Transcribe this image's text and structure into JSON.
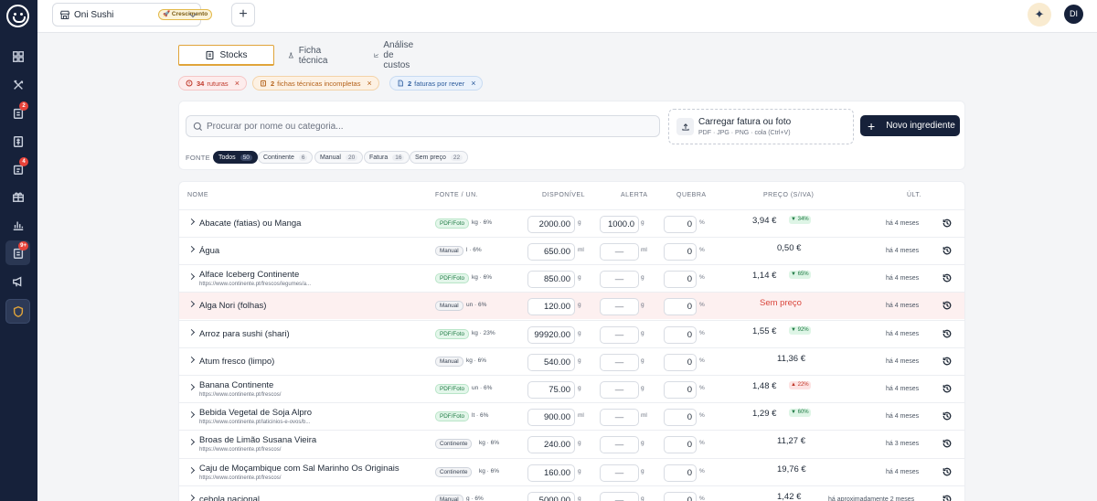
{
  "topbar": {
    "restaurant_name": "Oni Sushi",
    "plan_badge": "🚀 Crescimento",
    "add_label": "+",
    "ai_icon": "sparkle-icon",
    "avatar_initials": "DI"
  },
  "sidebar": {
    "items": [
      {
        "icon": "dashboard-icon",
        "badge": ""
      },
      {
        "icon": "utensils-icon",
        "badge": ""
      },
      {
        "icon": "orders-icon",
        "badge": "2"
      },
      {
        "icon": "invoice-icon",
        "badge": ""
      },
      {
        "icon": "delivery-icon",
        "badge": "4"
      },
      {
        "icon": "gift-icon",
        "badge": ""
      },
      {
        "icon": "chart-icon",
        "badge": ""
      },
      {
        "icon": "stock-icon",
        "badge": "9+"
      },
      {
        "icon": "megaphone-icon",
        "badge": ""
      },
      {
        "icon": "shield-icon",
        "badge": ""
      }
    ]
  },
  "tabs": [
    {
      "label": "Stocks",
      "selected": true
    },
    {
      "label": "Ficha técnica",
      "selected": false
    },
    {
      "label": "Análise de custos",
      "selected": false
    }
  ],
  "alerts": [
    {
      "count": "34",
      "label": "ruturas",
      "color": "#c0392b"
    },
    {
      "count": "2",
      "label": "fichas técnicas incompletas",
      "color": "#b4621a"
    },
    {
      "count": "2",
      "label": "faturas por rever",
      "color": "#2a5a9b"
    }
  ],
  "toolbar": {
    "search_placeholder": "Procurar por nome ou categoria...",
    "upload_title": "Carregar fatura ou foto",
    "upload_hint": "PDF · JPG · PNG · cola (Ctrl+V)",
    "new_button": "Novo ingrediente",
    "source_label": "FONTE",
    "filters": [
      {
        "label": "Todos",
        "count": "50",
        "selected": true
      },
      {
        "label": "Continente",
        "count": "6",
        "selected": false
      },
      {
        "label": "Manual",
        "count": "20",
        "selected": false
      },
      {
        "label": "Fatura",
        "count": "16",
        "selected": false
      },
      {
        "label": "Sem preço",
        "count": "22",
        "selected": false
      }
    ]
  },
  "table": {
    "headers": {
      "name": "NOME",
      "source": "FONTE / UN.",
      "available": "DISPONÍVEL",
      "alert": "ALERTA",
      "loss": "QUEBRA",
      "price": "PREÇO (S/IVA)",
      "last": "ÚLT."
    },
    "rows": [
      {
        "name": "Abacate (fatias) ou Manga",
        "url": "",
        "source": "PDF/Foto",
        "unit": "kg · 6%",
        "available": "2000.00",
        "avail_unit": "g",
        "alert": "1000.0",
        "alert_unit": "g",
        "loss": "0",
        "price": "3,94 €",
        "delta": "▼ 34%",
        "delta_dir": "down",
        "last": "há 4 meses"
      },
      {
        "name": "Água",
        "url": "",
        "source": "Manual",
        "unit": "l · 6%",
        "available": "650.00",
        "avail_unit": "ml",
        "alert": "—",
        "alert_unit": "ml",
        "loss": "0",
        "price": "0,50 €",
        "delta": "",
        "delta_dir": "",
        "last": "há 4 meses"
      },
      {
        "name": "Alface Iceberg Continente",
        "url": "https://www.continente.pt/frescos/legumes/a...",
        "source": "PDF/Foto",
        "unit": "kg · 6%",
        "available": "850.00",
        "avail_unit": "g",
        "alert": "—",
        "alert_unit": "g",
        "loss": "0",
        "price": "1,14 €",
        "delta": "▼ 65%",
        "delta_dir": "down",
        "last": "há 4 meses"
      },
      {
        "name": "Alga Nori (folhas)",
        "url": "",
        "source": "Manual",
        "unit": "un · 6%",
        "available": "120.00",
        "avail_unit": "g",
        "alert": "—",
        "alert_unit": "g",
        "loss": "0",
        "price": "Sem preço",
        "delta": "",
        "delta_dir": "",
        "last": "há 4 meses"
      },
      {
        "name": "Arroz para sushi (shari)",
        "url": "",
        "source": "PDF/Foto",
        "unit": "kg · 23%",
        "available": "99920.00",
        "avail_unit": "g",
        "alert": "—",
        "alert_unit": "g",
        "loss": "0",
        "price": "1,55 €",
        "delta": "▼ 92%",
        "delta_dir": "down",
        "last": "há 4 meses"
      },
      {
        "name": "Atum fresco (limpo)",
        "url": "",
        "source": "Manual",
        "unit": "kg · 6%",
        "available": "540.00",
        "avail_unit": "g",
        "alert": "—",
        "alert_unit": "g",
        "loss": "0",
        "price": "11,36 €",
        "delta": "",
        "delta_dir": "",
        "last": "há 4 meses"
      },
      {
        "name": "Banana Continente",
        "url": "https://www.continente.pt/frescos/",
        "source": "PDF/Foto",
        "unit": "un · 6%",
        "available": "75.00",
        "avail_unit": "g",
        "alert": "—",
        "alert_unit": "g",
        "loss": "0",
        "price": "1,48 €",
        "delta": "▲ 22%",
        "delta_dir": "up",
        "last": "há 4 meses"
      },
      {
        "name": "Bebida Vegetal de Soja Alpro",
        "url": "https://www.continente.pt/laticinios-e-ovos/b...",
        "source": "PDF/Foto",
        "unit": "lt · 6%",
        "available": "900.00",
        "avail_unit": "ml",
        "alert": "—",
        "alert_unit": "ml",
        "loss": "0",
        "price": "1,29 €",
        "delta": "▼ 60%",
        "delta_dir": "down",
        "last": "há 4 meses"
      },
      {
        "name": "Broas de Limão Susana Vieira",
        "url": "https://www.continente.pt/frescos/",
        "source": "Continente",
        "unit": "kg · 6%",
        "available": "240.00",
        "avail_unit": "g",
        "alert": "—",
        "alert_unit": "g",
        "loss": "0",
        "price": "11,27 €",
        "delta": "",
        "delta_dir": "",
        "last": "há 3 meses"
      },
      {
        "name": "Caju de Moçambique com Sal Marinho Os Originais",
        "url": "https://www.continente.pt/frescos/",
        "source": "Continente",
        "unit": "kg · 6%",
        "available": "160.00",
        "avail_unit": "g",
        "alert": "—",
        "alert_unit": "g",
        "loss": "0",
        "price": "19,76 €",
        "delta": "",
        "delta_dir": "",
        "last": "há 4 meses"
      },
      {
        "name": "cebola nacional",
        "url": "",
        "source": "Manual",
        "unit": "g · 6%",
        "available": "5000.00",
        "avail_unit": "g",
        "alert": "—",
        "alert_unit": "g",
        "loss": "0",
        "price": "1,42 €",
        "delta": "",
        "delta_dir": "",
        "last": "há aproximadamente 2 meses"
      }
    ]
  }
}
